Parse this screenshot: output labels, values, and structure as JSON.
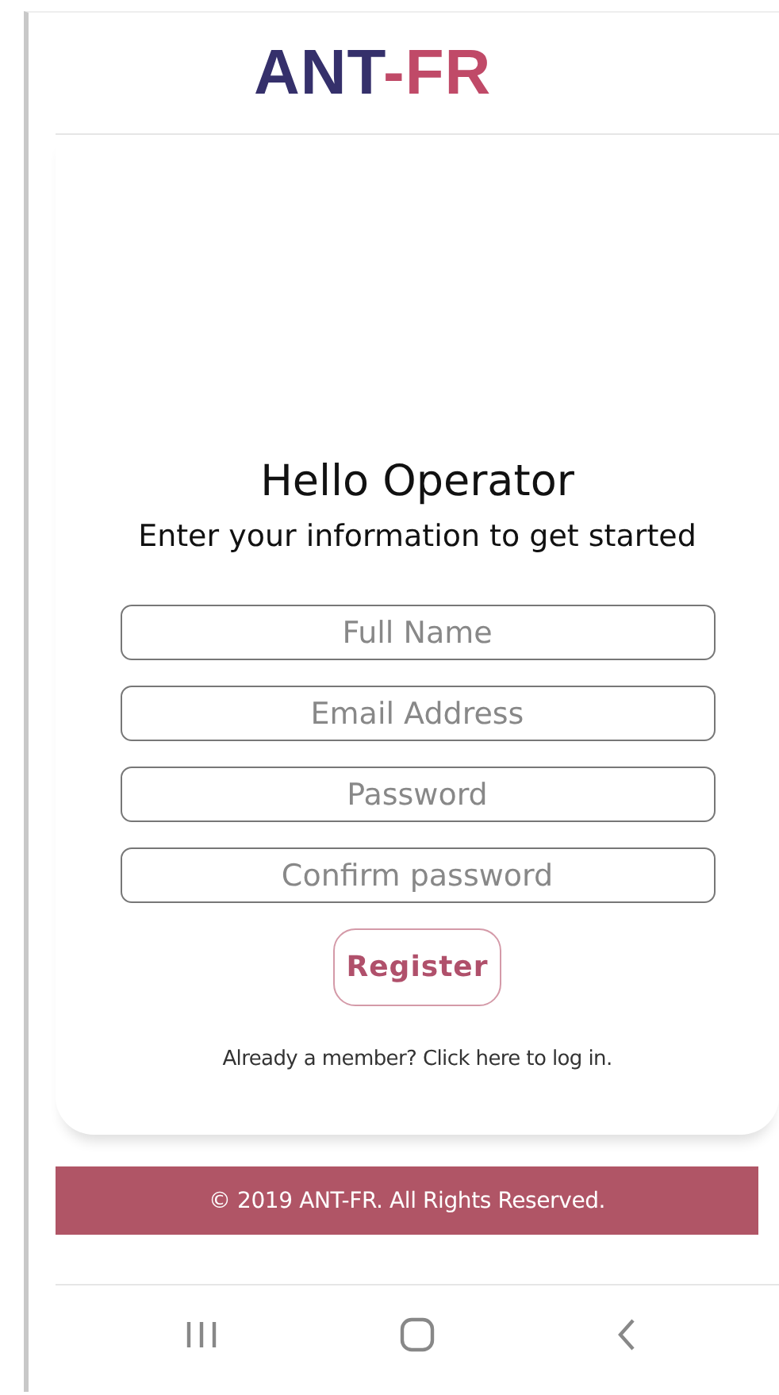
{
  "logo": {
    "parts": [
      {
        "text": "ANT",
        "color": "#35306b"
      },
      {
        "text": "-FR",
        "color": "#c04a68"
      }
    ]
  },
  "heading": "Hello Operator",
  "subheading": "Enter your information to get started",
  "fields": [
    {
      "placeholder": "Full Name"
    },
    {
      "placeholder": "Email Address"
    },
    {
      "placeholder": "Password"
    },
    {
      "placeholder": "Confirm password"
    }
  ],
  "register_button": "Register",
  "login_link": "Already a member? Click here to log in.",
  "footer": "© 2019 ANT-FR. All Rights Reserved."
}
